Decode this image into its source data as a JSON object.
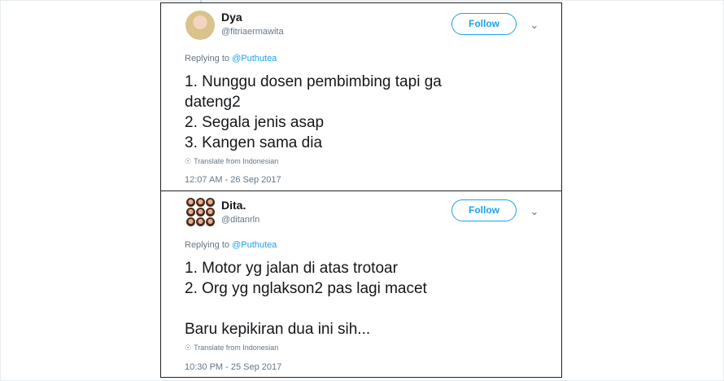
{
  "tweets": [
    {
      "name": "Dya",
      "handle": "@fitriaermawita",
      "follow_label": "Follow",
      "replying_to_prefix": "Replying to ",
      "replying_to_mention": "@Puthutea",
      "body_lines": [
        "1. Nunggu dosen pembimbing tapi ga",
        "dateng2",
        "2. Segala jenis asap",
        "3. Kangen sama dia"
      ],
      "translate_label": "Translate from Indonesian",
      "timestamp": "12:07 AM - 26 Sep 2017"
    },
    {
      "name": "Dita.",
      "handle": "@ditanrln",
      "follow_label": "Follow",
      "replying_to_prefix": "Replying to ",
      "replying_to_mention": "@Puthutea",
      "body_lines": [
        "1. Motor yg jalan di atas trotoar",
        "2. Org yg nglakson2 pas lagi macet",
        "",
        "Baru kepikiran dua ini sih..."
      ],
      "translate_label": "Translate from Indonesian",
      "timestamp": "10:30 PM - 25 Sep 2017"
    }
  ],
  "icons": {
    "caret": "chevron-down-icon",
    "translate": "globe-icon"
  },
  "colors": {
    "accent": "#1da1f2",
    "muted": "#657786",
    "text": "#14171a"
  }
}
